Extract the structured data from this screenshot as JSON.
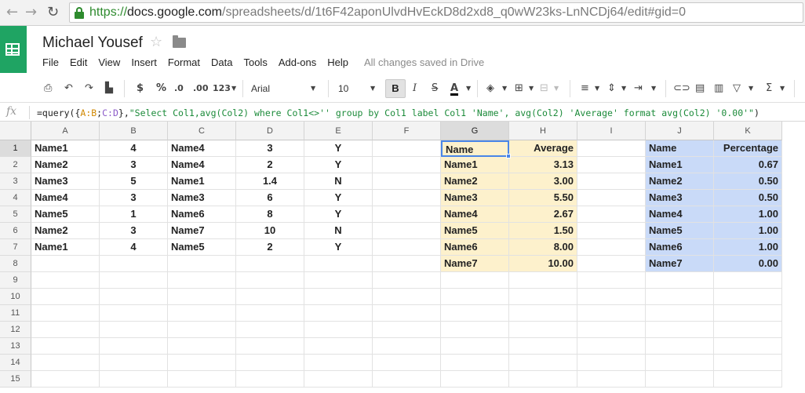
{
  "browser": {
    "url_scheme": "https://",
    "url_host": "docs.google.com",
    "url_path": "/spreadsheets/d/1t6F42aponUlvdHvEckD8d2xd8_q0wW23ks-LnNCDj64/edit#gid=0"
  },
  "doc": {
    "title": "Michael Yousef",
    "status": "All changes saved in Drive"
  },
  "menu": [
    "File",
    "Edit",
    "View",
    "Insert",
    "Format",
    "Data",
    "Tools",
    "Add-ons",
    "Help"
  ],
  "toolbar": {
    "currency": "$",
    "percent": "%",
    "dec_less": ".0",
    "dec_more": ".00",
    "more_formats": "123",
    "font": "Arial",
    "font_size": "10",
    "bold": "B",
    "italic": "I",
    "strike": "S",
    "text_color": "A",
    "sum": "Σ"
  },
  "formula": {
    "fx_label": "fx",
    "p1": "=query({",
    "r1": "A:B",
    "p2": ";",
    "r2": "C:D",
    "p3": "},",
    "s": "\"Select Col1,avg(Col2) where Col1<>'' group by Col1 label Col1 'Name', avg(Col2) 'Average' format avg(Col2) '0.00'\"",
    "p4": ")"
  },
  "grid": {
    "columns": [
      "A",
      "B",
      "C",
      "D",
      "E",
      "F",
      "G",
      "H",
      "I",
      "J",
      "K"
    ],
    "rows": [
      "1",
      "2",
      "3",
      "4",
      "5",
      "6",
      "7",
      "8",
      "9",
      "10",
      "11",
      "12",
      "13",
      "14",
      "15"
    ],
    "cells": {
      "A": [
        "Name1",
        "Name2",
        "Name3",
        "Name4",
        "Name5",
        "Name2",
        "Name1"
      ],
      "B": [
        "4",
        "3",
        "5",
        "3",
        "1",
        "3",
        "4"
      ],
      "C": [
        "Name4",
        "Name4",
        "Name1",
        "Name3",
        "Name6",
        "Name7",
        "Name5"
      ],
      "D": [
        "3",
        "2",
        "1.4",
        "6",
        "8",
        "10",
        "2"
      ],
      "E": [
        "Y",
        "Y",
        "N",
        "Y",
        "Y",
        "N",
        "Y"
      ],
      "G": [
        "Name",
        "Name1",
        "Name2",
        "Name3",
        "Name4",
        "Name5",
        "Name6",
        "Name7"
      ],
      "H": [
        "Average",
        "3.13",
        "3.00",
        "5.50",
        "2.67",
        "1.50",
        "8.00",
        "10.00"
      ],
      "J": [
        "Name",
        "Name1",
        "Name2",
        "Name3",
        "Name4",
        "Name5",
        "Name6",
        "Name7"
      ],
      "K": [
        "Percentage",
        "0.67",
        "0.50",
        "0.50",
        "1.00",
        "1.00",
        "1.00",
        "0.00"
      ]
    },
    "fill_colors": {
      "query_result": "#fdf1cc",
      "percentage_table": "#c9daf8",
      "selection": "#4a86e8"
    }
  }
}
